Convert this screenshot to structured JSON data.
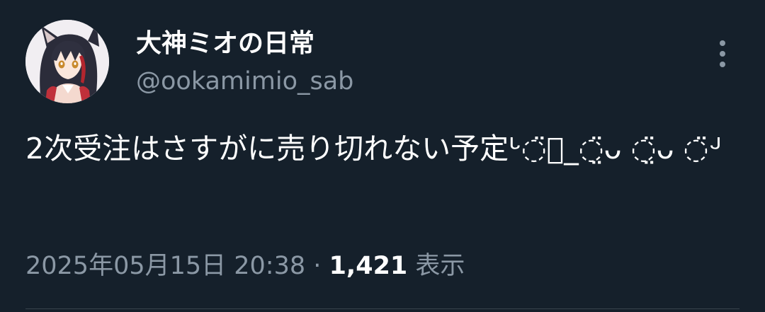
{
  "tweet": {
    "author": {
      "display_name": "大神ミオの日常",
      "handle": "@ookamimio_sab",
      "avatar_icon": "avatar-illustration"
    },
    "more_icon": "more-vertical-icon",
    "text": "2次受注はさすがに売り切れない予定ᒡ◌̈⃝_◌̤̈ᴗ ◌̤̈ᴗ ◌̈ᒢ",
    "timestamp": "2025年05月15日 20:38",
    "separator": "·",
    "views_count": "1,421",
    "views_label": "表示"
  },
  "colors": {
    "background": "#15202b",
    "primary_text": "#ffffff",
    "secondary_text": "#8b98a5",
    "divider": "#38444d"
  }
}
